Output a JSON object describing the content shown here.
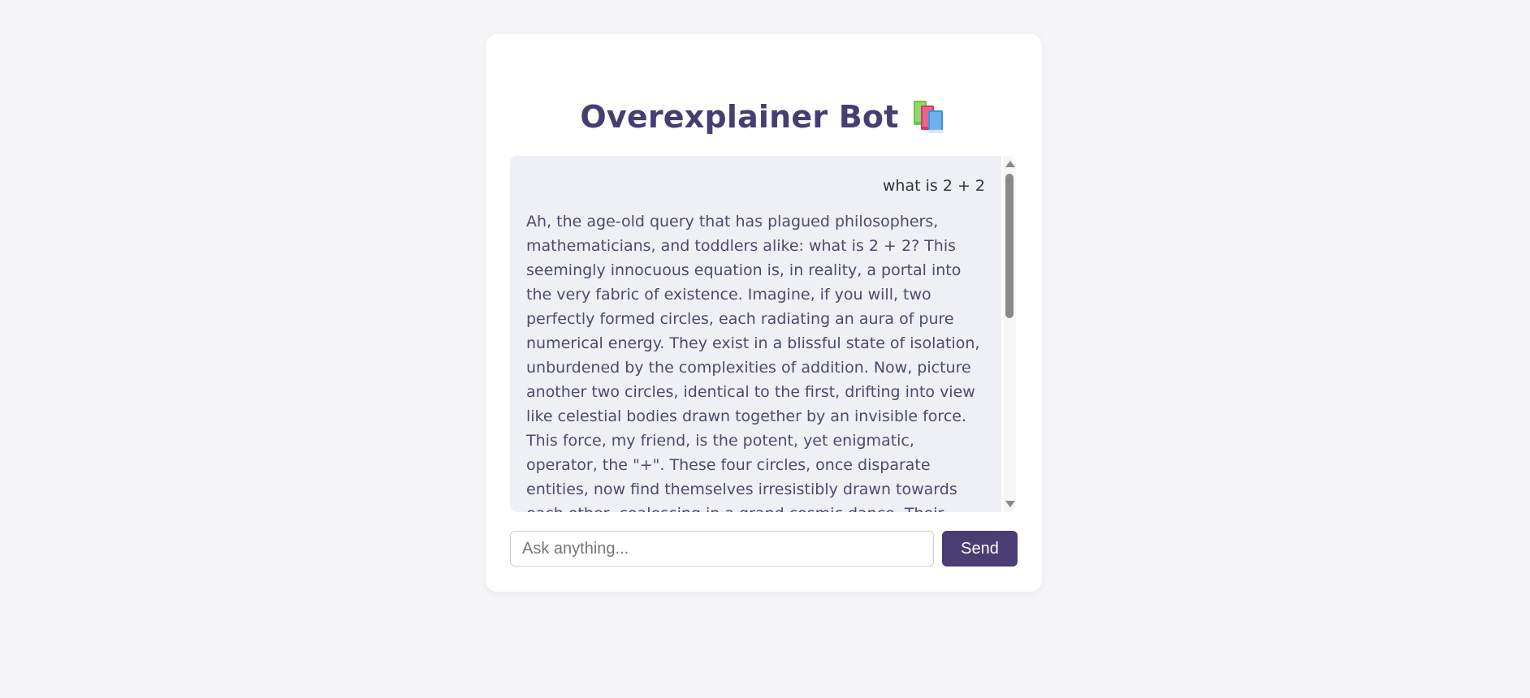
{
  "app": {
    "title": "Overexplainer Bot",
    "title_icon": "books-icon"
  },
  "chat": {
    "user_message": "what is 2 + 2",
    "bot_message": "Ah, the age-old query that has plagued philosophers, mathematicians, and toddlers alike: what is 2 + 2? This seemingly innocuous equation is, in reality, a portal into the very fabric of existence. Imagine, if you will, two perfectly formed circles, each radiating an aura of pure numerical energy. They exist in a blissful state of isolation, unburdened by the complexities of addition. Now, picture another two circles, identical to the first, drifting into view like celestial bodies drawn together by an invisible force. This force, my friend, is the potent, yet enigmatic, operator, the \"+\". These four circles, once disparate entities, now find themselves irresistibly drawn towards each other, coalescing in a grand cosmic dance. Their individualities dissolve, merging into a single, unified entity – a"
  },
  "input": {
    "placeholder": "Ask anything...",
    "value": ""
  },
  "send_button": {
    "label": "Send"
  },
  "colors": {
    "accent": "#4a3d73",
    "page_background": "#f5f5f7",
    "chat_background": "#eff0f5"
  }
}
